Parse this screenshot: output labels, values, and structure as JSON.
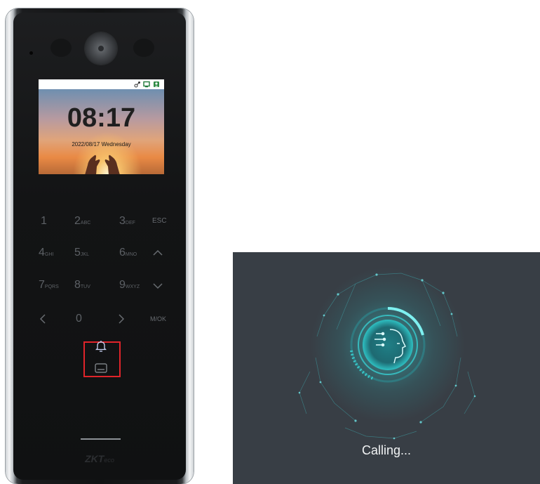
{
  "device": {
    "screen": {
      "time": "08:17",
      "date": "2022/08/17 Wednesday",
      "status_icons": [
        "network-icon",
        "monitor-icon",
        "user-icon"
      ]
    },
    "keypad": {
      "rows": [
        [
          {
            "main": "1",
            "sub": ""
          },
          {
            "main": "2",
            "sub": "ABC"
          },
          {
            "main": "3",
            "sub": "DEF"
          },
          {
            "word": "ESC"
          }
        ],
        [
          {
            "main": "4",
            "sub": "GHI"
          },
          {
            "main": "5",
            "sub": "JKL"
          },
          {
            "main": "6",
            "sub": "MNO"
          },
          {
            "icon": "up-arrow-icon"
          }
        ],
        [
          {
            "main": "7",
            "sub": "PQRS"
          },
          {
            "main": "8",
            "sub": "TUV"
          },
          {
            "main": "9",
            "sub": "WXYZ"
          },
          {
            "icon": "down-arrow-icon"
          }
        ],
        [
          {
            "icon": "left-arrow-icon"
          },
          {
            "main": "0",
            "sub": ""
          },
          {
            "icon": "right-arrow-icon"
          },
          {
            "word": "M/OK"
          }
        ]
      ],
      "special": {
        "doorbell": "bell-icon",
        "card": "card-icon"
      },
      "highlight_color": "#e0242a"
    },
    "brand": {
      "main": "ZKT",
      "sub": "eco"
    }
  },
  "calling": {
    "status_text": "Calling...",
    "accent_color": "#38c8c9",
    "background_color": "#383e45",
    "icon": "face-recognition-icon"
  }
}
